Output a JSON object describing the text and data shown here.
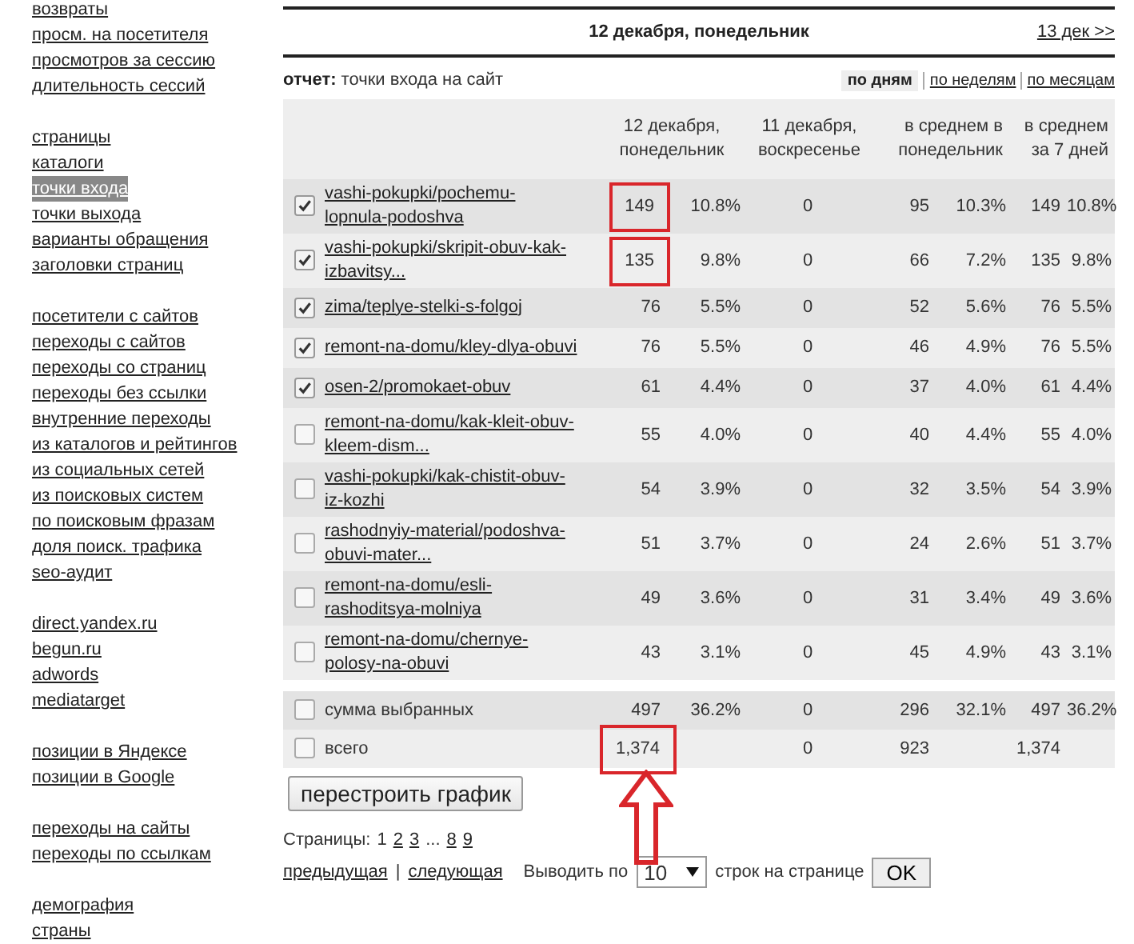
{
  "sidebar": {
    "groups": [
      {
        "items": [
          {
            "label": "возвраты",
            "selected": false
          },
          {
            "label": "просм. на посетителя",
            "selected": false
          },
          {
            "label": "просмотров за сессию",
            "selected": false
          },
          {
            "label": "длительность сессий",
            "selected": false
          }
        ]
      },
      {
        "items": [
          {
            "label": "страницы",
            "selected": false
          },
          {
            "label": "каталоги",
            "selected": false
          },
          {
            "label": "точки входа",
            "selected": true
          },
          {
            "label": "точки выхода",
            "selected": false
          },
          {
            "label": "варианты обращения",
            "selected": false
          },
          {
            "label": "заголовки страниц",
            "selected": false
          }
        ]
      },
      {
        "items": [
          {
            "label": "посетители с сайтов",
            "selected": false
          },
          {
            "label": "переходы с сайтов",
            "selected": false
          },
          {
            "label": "переходы со страниц",
            "selected": false
          },
          {
            "label": "переходы без ссылки",
            "selected": false
          },
          {
            "label": "внутренние переходы",
            "selected": false
          },
          {
            "label": "из каталогов и рейтингов",
            "selected": false
          },
          {
            "label": "из социальных сетей",
            "selected": false
          },
          {
            "label": "из поисковых систем",
            "selected": false
          },
          {
            "label": "по поисковым фразам",
            "selected": false
          },
          {
            "label": "доля поиск. трафика",
            "selected": false
          },
          {
            "label": "seo-аудит",
            "selected": false
          }
        ]
      },
      {
        "items": [
          {
            "label": "direct.yandex.ru",
            "selected": false
          },
          {
            "label": "begun.ru",
            "selected": false
          },
          {
            "label": "adwords",
            "selected": false
          },
          {
            "label": "mediatarget",
            "selected": false
          }
        ]
      },
      {
        "items": [
          {
            "label": "позиции в Яндексе",
            "selected": false
          },
          {
            "label": "позиции в Google",
            "selected": false
          }
        ]
      },
      {
        "items": [
          {
            "label": "переходы на сайты",
            "selected": false
          },
          {
            "label": "переходы по ссылкам",
            "selected": false
          }
        ]
      },
      {
        "items": [
          {
            "label": "демография",
            "selected": false
          },
          {
            "label": "страны",
            "selected": false
          }
        ]
      }
    ]
  },
  "date_bar": {
    "title": "12 декабря, понедельник",
    "next_link": "13 дек >>"
  },
  "report": {
    "label": "отчет:",
    "name": "точки входа на сайт"
  },
  "periods": [
    {
      "label": "по дням",
      "selected": true
    },
    {
      "label": "по неделям",
      "selected": false
    },
    {
      "label": "по месяцам",
      "selected": false
    }
  ],
  "table": {
    "columns": [
      "12 декабря, понедельник",
      "11 декабря, воскресенье",
      "в среднем в понедельник",
      "в среднем за 7 дней"
    ],
    "rows": [
      {
        "kind": "page",
        "checked": true,
        "label": "vashi-pokupki/pochemu-lopnula-podoshva",
        "highlighted": true,
        "values": {
          "d12": "149",
          "d12_pct": "10.8%",
          "d11": "0",
          "mon": "95",
          "mon_pct": "10.3%",
          "avg7": "149",
          "avg7_pct": "10.8%"
        }
      },
      {
        "kind": "page",
        "checked": true,
        "label": "vashi-pokupki/skripit-obuv-kak-izbavitsy...",
        "highlighted": true,
        "values": {
          "d12": "135",
          "d12_pct": "9.8%",
          "d11": "0",
          "mon": "66",
          "mon_pct": "7.2%",
          "avg7": "135",
          "avg7_pct": "9.8%"
        }
      },
      {
        "kind": "page",
        "checked": true,
        "label": "zima/teplye-stelki-s-folgoj",
        "highlighted": false,
        "values": {
          "d12": "76",
          "d12_pct": "5.5%",
          "d11": "0",
          "mon": "52",
          "mon_pct": "5.6%",
          "avg7": "76",
          "avg7_pct": "5.5%"
        }
      },
      {
        "kind": "page",
        "checked": true,
        "label": "remont-na-domu/kley-dlya-obuvi",
        "highlighted": false,
        "values": {
          "d12": "76",
          "d12_pct": "5.5%",
          "d11": "0",
          "mon": "46",
          "mon_pct": "4.9%",
          "avg7": "76",
          "avg7_pct": "5.5%"
        }
      },
      {
        "kind": "page",
        "checked": true,
        "label": "osen-2/promokaet-obuv",
        "highlighted": false,
        "values": {
          "d12": "61",
          "d12_pct": "4.4%",
          "d11": "0",
          "mon": "37",
          "mon_pct": "4.0%",
          "avg7": "61",
          "avg7_pct": "4.4%"
        }
      },
      {
        "kind": "page",
        "checked": false,
        "label": "remont-na-domu/kak-kleit-obuv-kleem-dism...",
        "highlighted": false,
        "values": {
          "d12": "55",
          "d12_pct": "4.0%",
          "d11": "0",
          "mon": "40",
          "mon_pct": "4.4%",
          "avg7": "55",
          "avg7_pct": "4.0%"
        }
      },
      {
        "kind": "page",
        "checked": false,
        "label": "vashi-pokupki/kak-chistit-obuv-iz-kozhi",
        "highlighted": false,
        "values": {
          "d12": "54",
          "d12_pct": "3.9%",
          "d11": "0",
          "mon": "32",
          "mon_pct": "3.5%",
          "avg7": "54",
          "avg7_pct": "3.9%"
        }
      },
      {
        "kind": "page",
        "checked": false,
        "label": "rashodnyiy-material/podoshva-obuvi-mater...",
        "highlighted": false,
        "values": {
          "d12": "51",
          "d12_pct": "3.7%",
          "d11": "0",
          "mon": "24",
          "mon_pct": "2.6%",
          "avg7": "51",
          "avg7_pct": "3.7%"
        }
      },
      {
        "kind": "page",
        "checked": false,
        "label": "remont-na-domu/esli-rashoditsya-molniya",
        "highlighted": false,
        "values": {
          "d12": "49",
          "d12_pct": "3.6%",
          "d11": "0",
          "mon": "31",
          "mon_pct": "3.4%",
          "avg7": "49",
          "avg7_pct": "3.6%"
        }
      },
      {
        "kind": "page",
        "checked": false,
        "label": "remont-na-domu/chernye-polosy-na-obuvi",
        "highlighted": false,
        "values": {
          "d12": "43",
          "d12_pct": "3.1%",
          "d11": "0",
          "mon": "45",
          "mon_pct": "4.9%",
          "avg7": "43",
          "avg7_pct": "3.1%"
        }
      },
      {
        "kind": "sum",
        "checked": false,
        "label": "сумма выбранных",
        "highlighted": false,
        "values": {
          "d12": "497",
          "d12_pct": "36.2%",
          "d11": "0",
          "mon": "296",
          "mon_pct": "32.1%",
          "avg7": "497",
          "avg7_pct": "36.2%"
        }
      },
      {
        "kind": "sum",
        "checked": false,
        "label": "всего",
        "highlighted": true,
        "values": {
          "d12": "1,374",
          "d11": "0",
          "mon": "923",
          "avg7": "1,374"
        }
      }
    ]
  },
  "rebuild_button": "перестроить график",
  "pagination": {
    "label": "Страницы:",
    "pages": [
      {
        "label": "1",
        "selected": true
      },
      {
        "label": "2",
        "selected": false
      },
      {
        "label": "3",
        "selected": false
      },
      {
        "kind": "ellipsis",
        "label": "..."
      },
      {
        "label": "8",
        "selected": false
      },
      {
        "label": "9",
        "selected": false
      }
    ]
  },
  "footer": {
    "prev": "предыдущая",
    "separator": "|",
    "next": "следующая",
    "show_label": "Выводить по",
    "per_page": "10",
    "per_page_suffix": "строк на странице",
    "ok": "OK"
  }
}
